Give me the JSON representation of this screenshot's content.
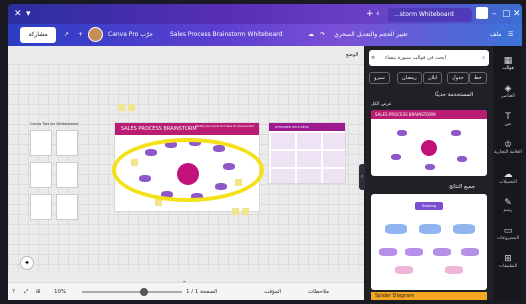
{
  "browser": {
    "tab_title": "...storm Whiteboard",
    "window_controls": [
      "minimize-icon",
      "maximize-icon",
      "close-icon"
    ]
  },
  "editor_bar": {
    "share_label": "مشاركة",
    "canva_pro": "Canva Pro جرّب",
    "doc_title": "Sales Process Brainstorm Whiteboard",
    "upgrade_label": "تغيير الحجم والتعديل السحري",
    "file_label": "ملف"
  },
  "canvas": {
    "top_label": "الوضع",
    "tips_title": "Canva Tips for Whiteboards",
    "board_title": "SALES PROCESS BRAINSTORM",
    "board_subtitle": "Identify pain points and ideas for improvement",
    "side_board_title": "ATTENDED HELP DESK"
  },
  "bottom_bar": {
    "notes_label": "ملاحظات",
    "timer_label": "المؤقت",
    "page_label": "الصفحة 1 / 1",
    "zoom_label": "10%"
  },
  "side_panel": {
    "search_placeholder": "ابحث في قوالب سبورة بيضاء",
    "chips": [
      "خط",
      "جدول",
      "ابلان",
      "رمضان",
      "سيرو"
    ],
    "recent_title": "المستخدمة حديثًا",
    "recent_link": "عرض الكل",
    "all_results_title": "جميع النتائج",
    "spider_label": "Spider Diagram",
    "thumb1_title": "SALES PROCESS BRAINSTORM",
    "thumb2_title": "Drawing"
  },
  "rail": {
    "items": [
      {
        "label": "قوالب",
        "icon": "template-icon"
      },
      {
        "label": "العناصر",
        "icon": "elements-icon"
      },
      {
        "label": "نص",
        "icon": "text-icon"
      },
      {
        "label": "العلامة التجارية",
        "icon": "brand-icon"
      },
      {
        "label": "التحميلات",
        "icon": "upload-icon"
      },
      {
        "label": "رسم",
        "icon": "draw-icon"
      },
      {
        "label": "المشروعات",
        "icon": "projects-icon"
      },
      {
        "label": "التطبيقات",
        "icon": "apps-icon"
      }
    ]
  },
  "colors": {
    "accent": "#7b3fd3",
    "board_header": "#b91d73",
    "highlight": "#f4e11a"
  }
}
